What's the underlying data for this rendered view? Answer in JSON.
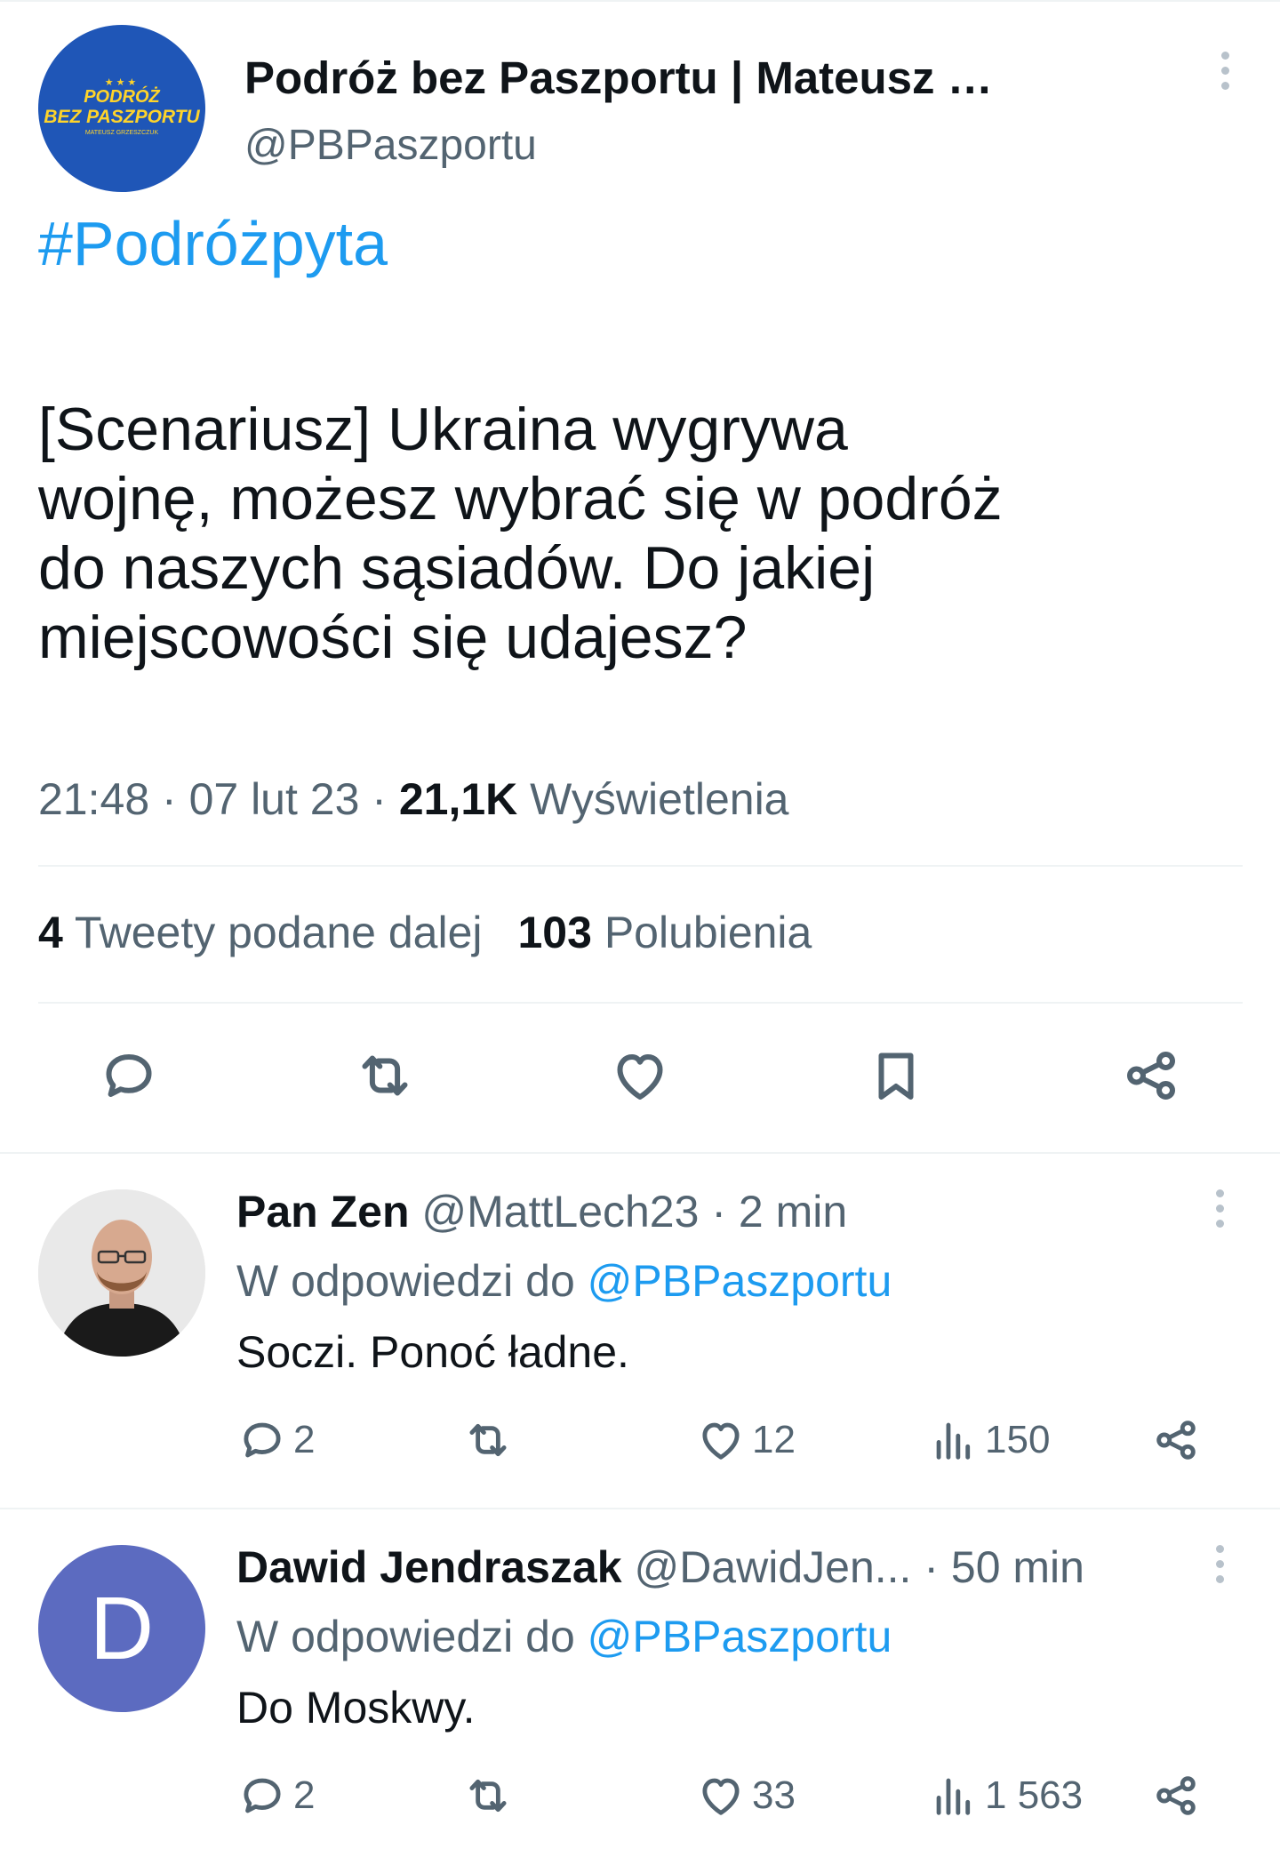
{
  "main_tweet": {
    "logo": {
      "line1": "PODRÓŻ",
      "line2": "BEZ PASZPORTU",
      "line3": "MATEUSZ GRZESZCZUK",
      "stars": "★★★"
    },
    "display_name": "Podróż bez Paszportu | Mateusz Grze...",
    "handle": "@PBPaszportu",
    "hashtag": "#Podróżpyta",
    "text": "[Scenariusz] Ukraina wygrywa\nwojnę, możesz wybrać się w podróż\ndo naszych sąsiadów. Do jakiej\nmiejscowości się udajesz?",
    "time": "21:48",
    "date": "07 lut 23",
    "views_count": "21,1K",
    "views_label": "Wyświetlenia",
    "retweets_count": "4",
    "retweets_label": "Tweety podane dalej",
    "likes_count": "103",
    "likes_label": "Polubienia",
    "actions": [
      "reply-icon",
      "retweet-icon",
      "like-icon",
      "bookmark-icon",
      "share-icon"
    ]
  },
  "replies": [
    {
      "name": "Pan Zen",
      "handle": "@MattLech23",
      "time": "2 min",
      "reply_to_prefix": "W odpowiedzi do",
      "reply_to_handle": "@PBPaszportu",
      "text": "Soczi. Ponoć ładne.",
      "replies": "2",
      "retweets": "",
      "likes": "12",
      "views": "150"
    },
    {
      "name": "Dawid Jendraszak",
      "handle": "@DawidJen...",
      "time": "50 min",
      "avatar_letter": "D",
      "reply_to_prefix": "W odpowiedzi do",
      "reply_to_handle": "@PBPaszportu",
      "text": "Do Moskwy.",
      "replies": "2",
      "retweets": "",
      "likes": "33",
      "views": "1 563"
    }
  ],
  "colors": {
    "link": "#1d9bf0",
    "secondary": "#536471",
    "primary": "#0f1419",
    "avatar_purple": "#5c6bc0",
    "logo_blue": "#1f56b7",
    "logo_yellow": "#ffd42a"
  }
}
